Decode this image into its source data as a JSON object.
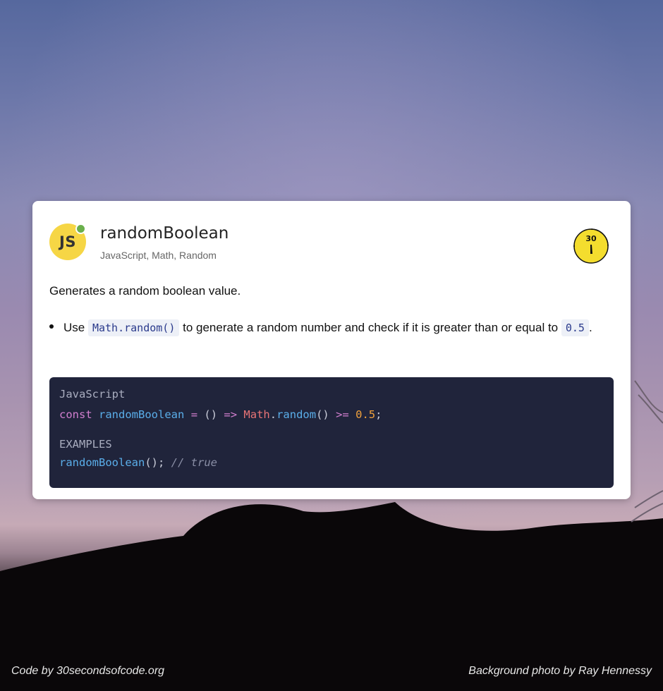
{
  "snippet": {
    "title": "randomBoolean",
    "tags": "JavaScript, Math, Random",
    "logo_text": "JS",
    "badge_text": "30",
    "description": "Generates a random boolean value.",
    "bullet": {
      "prefix": "Use ",
      "code1": "Math.random()",
      "middle": " to generate a random number and check if it is greater than or equal to ",
      "code2": "0.5",
      "suffix": "."
    }
  },
  "code_block": {
    "language": "JavaScript",
    "code_tokens": {
      "kw_const": "const",
      "name": "randomBoolean",
      "eq": "=",
      "parens": "()",
      "arrow": "=>",
      "obj": "Math",
      "dot": ".",
      "method": "random",
      "call": "()",
      "gte": ">=",
      "value": "0.5",
      "semi": ";"
    },
    "examples_label": "EXAMPLES",
    "example_tokens": {
      "fn": "randomBoolean",
      "call": "();",
      "comment": "// true"
    }
  },
  "footer": {
    "left": "Code by 30secondsofcode.org",
    "right": "Background photo by Ray Hennessy"
  },
  "colors": {
    "logo": "#f6d645",
    "online": "#6ab04c",
    "code_bg": "#20243b"
  },
  "icons": [
    "js-logo-icon",
    "online-status-dot",
    "30-seconds-badge-icon"
  ]
}
